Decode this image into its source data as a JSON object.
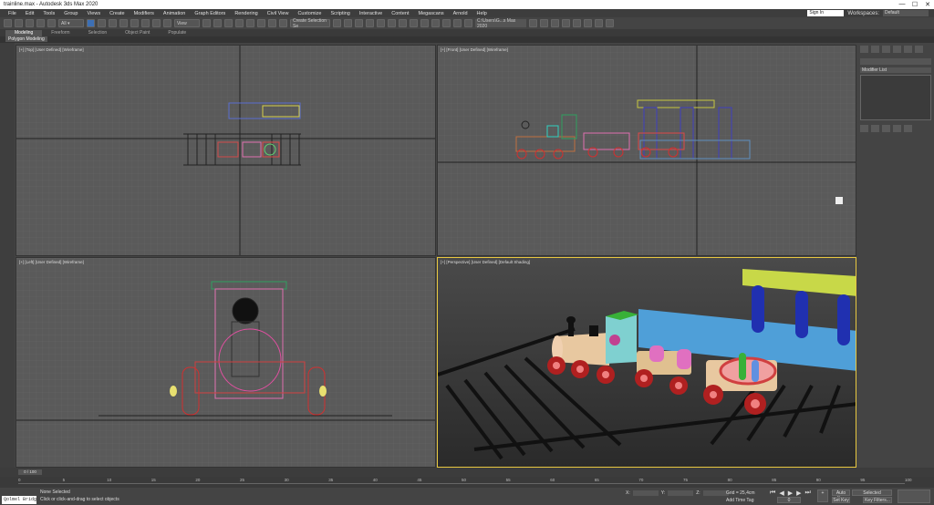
{
  "title": "trainline.max - Autodesk 3ds Max 2020",
  "window_buttons": [
    "—",
    "☐",
    "✕"
  ],
  "menu": [
    "File",
    "Edit",
    "Tools",
    "Group",
    "Views",
    "Create",
    "Modifiers",
    "Animation",
    "Graph Editors",
    "Rendering",
    "Civil View",
    "Customize",
    "Scripting",
    "Interactive",
    "Content",
    "Megascans",
    "Arnold",
    "Help"
  ],
  "sign_in": "Sign In",
  "workspaces_label": "Workspaces:",
  "workspace": "Default",
  "toolbar": {
    "view_combo": "View",
    "selection_set": "Create Selection Se",
    "project_path": "C:\\Users\\G...s Max 2020"
  },
  "ribbon_tabs": [
    "Modeling",
    "Freeform",
    "Selection",
    "Object Paint",
    "Populate"
  ],
  "ribbon_sub": "Polygon Modeling",
  "viewports": {
    "top": "[+] [Top] [User Defined] [Wireframe]",
    "front": "[+] [Front] [User Defined] [Wireframe]",
    "left": "[+] [Left] [User Defined] [Wireframe]",
    "persp": "[+] [Perspective] [User Defined] [Default Shading]"
  },
  "command_panel": {
    "modifier_list": "Modifier List"
  },
  "time": {
    "frame": "0 / 100",
    "ticks": [
      "0",
      "5",
      "10",
      "15",
      "20",
      "25",
      "30",
      "35",
      "40",
      "45",
      "50",
      "55",
      "60",
      "65",
      "70",
      "75",
      "80",
      "85",
      "90",
      "95",
      "100"
    ]
  },
  "status": {
    "maxscript": "Qolmel Bridg",
    "line1": "None Selected",
    "line2": "Click or click-and-drag to select objects",
    "x_label": "X:",
    "y_label": "Y:",
    "z_label": "Z:",
    "grid": "Grid = 25,4cm",
    "add_time_tag": "Add Time Tag",
    "auto_key": "Auto Key",
    "set_key": "Set Key",
    "selected": "Selected",
    "key_filters": "Key Filters...",
    "frame_value": "0"
  }
}
